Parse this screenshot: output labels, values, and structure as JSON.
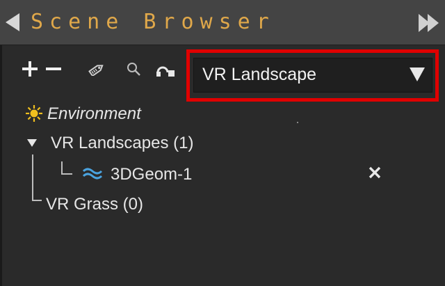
{
  "window": {
    "title": "Scene Browser"
  },
  "toolbar": {
    "add_icon": "plus-icon",
    "remove_icon": "minus-icon",
    "tag_icon": "tag-icon",
    "search_icon": "search-icon",
    "link_icon": "link-icon"
  },
  "filter_dropdown": {
    "selected": "VR Landscape",
    "highlight_color": "#e00000"
  },
  "tree": {
    "environment": {
      "label": "Environment",
      "icon": "sun-icon"
    },
    "groups": [
      {
        "label": "VR Landscapes (1)",
        "expanded": true,
        "children": [
          {
            "label": "3DGeom-1",
            "icon": "landscape-wave-icon"
          }
        ]
      },
      {
        "label": "VR Grass (0)",
        "expanded": false,
        "children": []
      }
    ]
  },
  "colors": {
    "title_text": "#e0a84a",
    "panel_bg": "#2a2a2a",
    "titlebar_bg": "#444444",
    "sun": "#f2c01e",
    "wave": "#4aa3df"
  }
}
